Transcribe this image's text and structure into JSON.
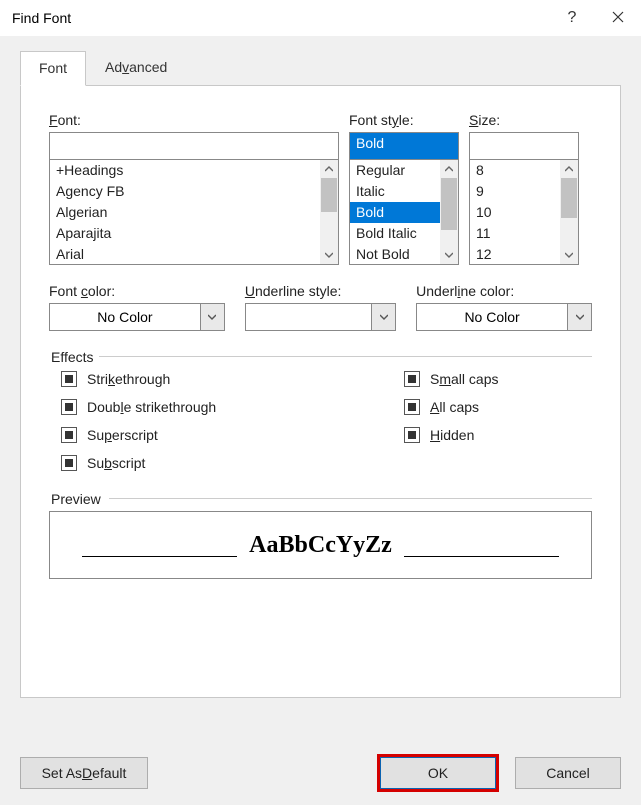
{
  "window": {
    "title": "Find Font"
  },
  "tabs": {
    "font": "Font",
    "advanced": "Advanced"
  },
  "font": {
    "label": "Font:",
    "value": "",
    "items": [
      "+Headings",
      "Agency FB",
      "Algerian",
      "Aparajita",
      "Arial"
    ]
  },
  "style": {
    "label": "Font style:",
    "value": "Bold",
    "items": [
      "Regular",
      "Italic",
      "Bold",
      "Bold Italic",
      "Not Bold"
    ],
    "selected_index": 2
  },
  "size": {
    "label": "Size:",
    "value": "",
    "items": [
      "8",
      "9",
      "10",
      "11",
      "12"
    ]
  },
  "color": {
    "label": "Font color:",
    "value": "No Color"
  },
  "underline": {
    "label": "Underline style:",
    "value": ""
  },
  "ucolor": {
    "label": "Underline color:",
    "value": "No Color"
  },
  "effects": {
    "legend": "Effects",
    "strike": "Strikethrough",
    "dstrike": "Double strikethrough",
    "super": "Superscript",
    "sub": "Subscript",
    "small": "Small caps",
    "all": "All caps",
    "hidden": "Hidden"
  },
  "preview": {
    "legend": "Preview",
    "sample": "AaBbCcYyZz"
  },
  "buttons": {
    "default": "Set As Default",
    "ok": "OK",
    "cancel": "Cancel"
  }
}
